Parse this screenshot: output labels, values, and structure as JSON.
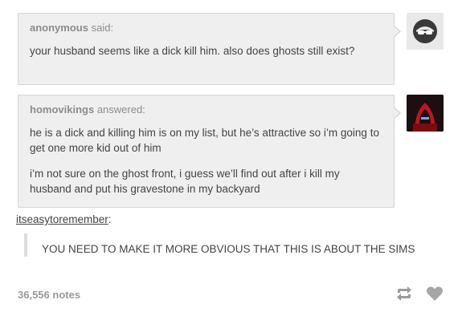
{
  "ask": {
    "asker": "anonymous",
    "said": "said:",
    "question": "your husband seems like a dick kill him. also does ghosts still exist?"
  },
  "answer": {
    "author": "homovikings",
    "answered": "answered:",
    "paragraph1": "he is a dick and killing him is on my list, but he’s attractive so i’m going to get one more kid out of him",
    "paragraph2": "i’m not sure on the ghost front, i guess we’ll find out after i kill my husband and put his gravestone in my backyard"
  },
  "reblog": {
    "user": "itseasytoremember",
    "colon": ":",
    "comment": "YOU NEED TO MAKE IT MORE OBVIOUS THAT THIS IS ABOUT THE SIMS"
  },
  "footer": {
    "notes": "36,556 notes"
  },
  "icons": {
    "avatar1": "anonymous-avatar-icon",
    "avatar2": "hooded-figure-avatar-icon",
    "reblog": "reblog-icon",
    "like": "heart-icon"
  },
  "colors": {
    "bubble_bg": "#efefef",
    "text": "#444444",
    "muted": "#8c8c8c"
  }
}
